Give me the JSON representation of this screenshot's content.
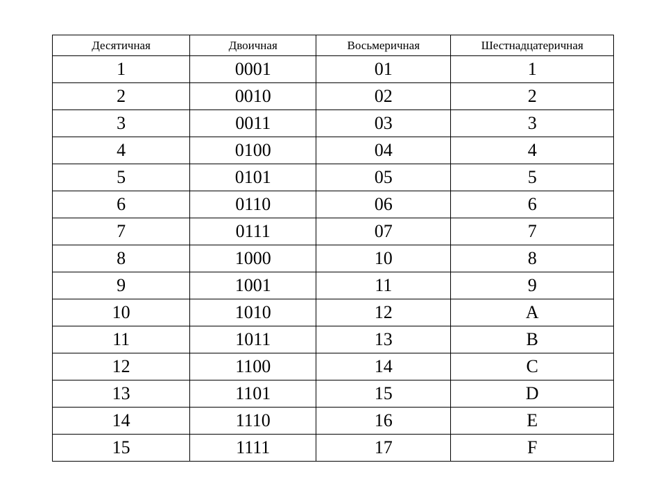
{
  "headers": [
    "Десятичная",
    "Двоичная",
    "Восьмеричная",
    "Шестнадцатеричная"
  ],
  "rows": [
    [
      "1",
      "0001",
      "01",
      "1"
    ],
    [
      "2",
      "0010",
      "02",
      "2"
    ],
    [
      "3",
      "0011",
      "03",
      "3"
    ],
    [
      "4",
      "0100",
      "04",
      "4"
    ],
    [
      "5",
      "0101",
      "05",
      "5"
    ],
    [
      "6",
      "0110",
      "06",
      "6"
    ],
    [
      "7",
      "0111",
      "07",
      "7"
    ],
    [
      "8",
      "1000",
      "10",
      "8"
    ],
    [
      "9",
      "1001",
      "11",
      "9"
    ],
    [
      "10",
      "1010",
      "12",
      "A"
    ],
    [
      "11",
      "1011",
      "13",
      "B"
    ],
    [
      "12",
      "1100",
      "14",
      "C"
    ],
    [
      "13",
      "1101",
      "15",
      "D"
    ],
    [
      "14",
      "1110",
      "16",
      "E"
    ],
    [
      "15",
      "1111",
      "17",
      "F"
    ]
  ]
}
